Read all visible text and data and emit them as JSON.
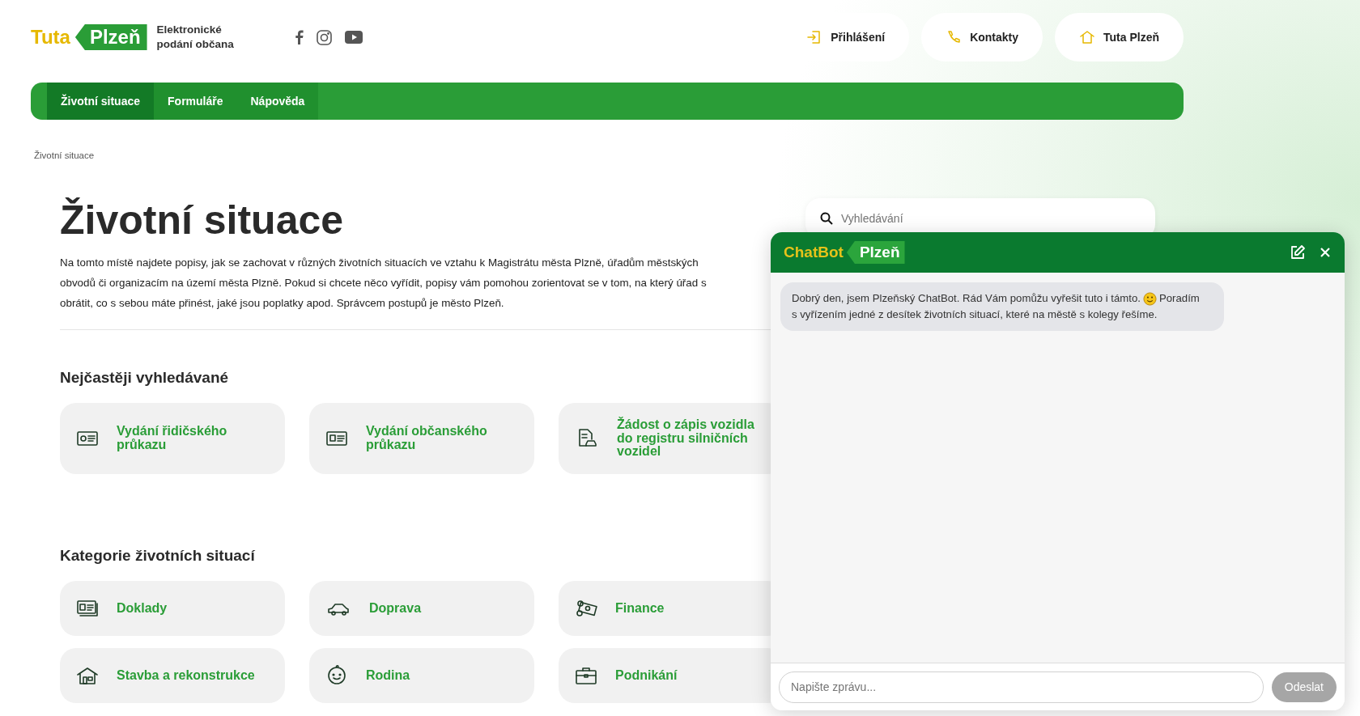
{
  "header": {
    "logo": {
      "word_1": "Tuta",
      "word_2": "Plzeň"
    },
    "tagline": "Elektronické podání občana",
    "buttons": [
      {
        "label": "Přihlášení",
        "kind": "login"
      },
      {
        "label": "Kontakty",
        "kind": "phone"
      },
      {
        "label": "Tuta Plzeň",
        "kind": "home"
      }
    ]
  },
  "nav": {
    "tabs": [
      {
        "label": "Životní situace",
        "selected": true
      },
      {
        "label": "Formuláře",
        "selected": false
      },
      {
        "label": "Nápověda",
        "selected": false
      }
    ]
  },
  "breadcrumb": "Životní situace",
  "title": "Životní situace",
  "description_lines": [
    "Na tomto místě najdete popisy, jak se zachovat v různých životních situacích ve vztahu k Magistrátu města Plzně, úřadům městských",
    "obvodů či organizacím na území města Plzně. Pokud si chcete něco vyřídit, popisy vám pomohou zorientovat se v tom, na který úřad s",
    "obrátit, co s sebou máte přinést, jaké jsou poplatky apod. Správcem postupů je město Plzeň."
  ],
  "search": {
    "placeholder": "Vyhledávání"
  },
  "sections": [
    {
      "heading": "Nejčastěji vyhledávané",
      "kind": "featured",
      "cards": [
        {
          "label": "Vydání řidičského průkazu",
          "kind": "license"
        },
        {
          "label": "Vydání občanského průkazu",
          "kind": "id"
        },
        {
          "label": "Žádost o zápis vozidla do registru silničních vozidel",
          "kind": "vehicle-doc"
        }
      ]
    },
    {
      "heading": "Kategorie životních situací",
      "kind": "category",
      "cards": [
        {
          "label": "Doklady",
          "kind": "documents"
        },
        {
          "label": "Doprava",
          "kind": "car"
        },
        {
          "label": "Finance",
          "kind": "money"
        },
        {
          "label": "Stavba a rekonstrukce",
          "kind": "house"
        },
        {
          "label": "Rodina",
          "kind": "baby"
        },
        {
          "label": "Podnikání",
          "kind": "briefcase"
        }
      ]
    }
  ],
  "chatbot": {
    "title_1": "ChatBot",
    "title_2": "Plzeň",
    "messages": [
      {
        "text_1": "Dobrý den, jsem Plzeňský ChatBot. Rád Vám pomůžu vyřešit tuto i támto.",
        "text_2": "Poradím",
        "text_3": "s vyřízením jedné z desítek životních situací, které na městě s kolegy řešíme."
      }
    ],
    "input": {
      "placeholder": "Napište zprávu..."
    },
    "send": {
      "label": "Odeslat",
      "disabled": true
    }
  }
}
